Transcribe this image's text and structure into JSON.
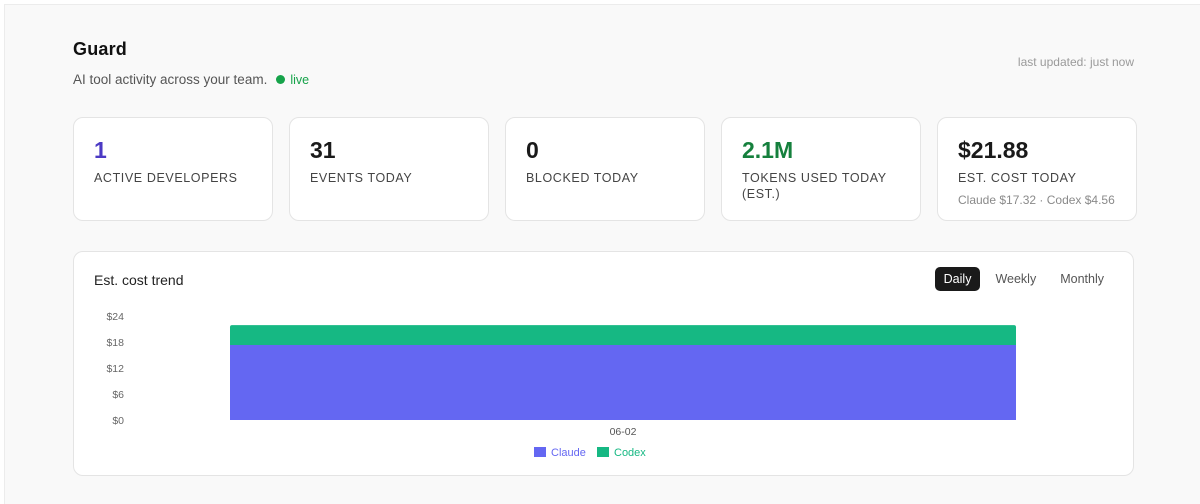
{
  "header": {
    "title": "Guard",
    "subtitle": "AI tool activity across your team.",
    "live_label": "live",
    "last_updated": "last updated: just now"
  },
  "cards": [
    {
      "value": "1",
      "label": "ACTIVE DEVELOPERS",
      "sub": ""
    },
    {
      "value": "31",
      "label": "EVENTS TODAY",
      "sub": ""
    },
    {
      "value": "0",
      "label": "BLOCKED TODAY",
      "sub": ""
    },
    {
      "value": "2.1M",
      "label": "TOKENS USED TODAY (EST.)",
      "sub": ""
    },
    {
      "value": "$21.88",
      "label": "EST. COST TODAY",
      "sub": "Claude $17.32 · Codex $4.56"
    }
  ],
  "chart_panel": {
    "title": "Est. cost trend",
    "tabs": [
      "Daily",
      "Weekly",
      "Monthly"
    ],
    "active_tab": "Daily"
  },
  "colors": {
    "claude": "#6467f2",
    "codex": "#16b883",
    "live": "#16a34a",
    "developers_value": "#4c3ac4",
    "tokens_value": "#15803d"
  },
  "chart_data": {
    "type": "area",
    "stacked": true,
    "x": [
      "06-02"
    ],
    "series": [
      {
        "name": "Claude",
        "values": [
          17.32
        ]
      },
      {
        "name": "Codex",
        "values": [
          4.56
        ]
      }
    ],
    "yticks": [
      "$0",
      "$6",
      "$12",
      "$18",
      "$24"
    ],
    "ylim": [
      0,
      24
    ],
    "legend_position": "bottom-center",
    "grid": false
  }
}
